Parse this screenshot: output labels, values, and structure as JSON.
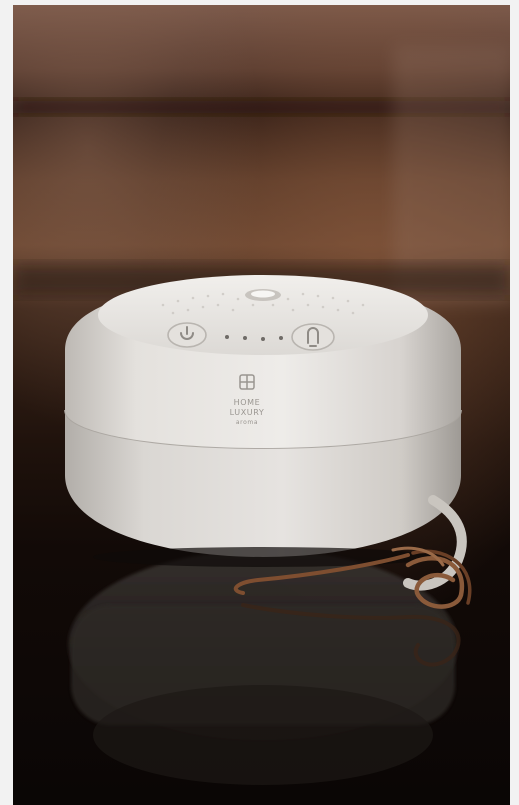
{
  "photo": {
    "subject": "white round aroma diffuser with leather strap on reflective dark table",
    "product": {
      "brand_line1": "HOME",
      "brand_line2": "LUXURY",
      "brand_line3": "aroma",
      "controls": [
        {
          "name": "power-button",
          "symbol": "power-icon"
        },
        {
          "name": "light-button",
          "symbol": "bulb-icon"
        }
      ],
      "indicator_dots": 4
    },
    "colors": {
      "background_dark": "#1a0f0b",
      "background_warm": "#7a4a33",
      "device_white": "#e6e3df",
      "device_shadow": "#b8b4af",
      "strap": "#8a5a3a",
      "page_margin": "#f2f2f2"
    }
  }
}
